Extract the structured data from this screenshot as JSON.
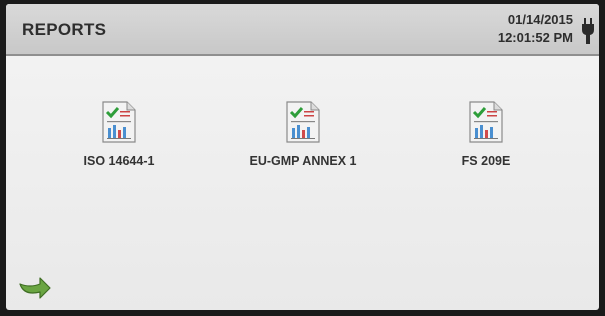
{
  "header": {
    "title": "REPORTS",
    "date": "01/14/2015",
    "time": "12:01:52 PM",
    "power_icon": "plug-icon"
  },
  "reports": [
    {
      "label": "ISO 14644-1",
      "icon": "report-document-icon"
    },
    {
      "label": "EU-GMP ANNEX 1",
      "icon": "report-document-icon"
    },
    {
      "label": "FS 209E",
      "icon": "report-document-icon"
    }
  ],
  "footer": {
    "back_icon": "back-arrow-icon"
  },
  "colors": {
    "header_bg": "#cfcfcf",
    "screen_bg": "#efefef",
    "check_green": "#2e9e3a",
    "arrow_green": "#5f9a3a"
  }
}
